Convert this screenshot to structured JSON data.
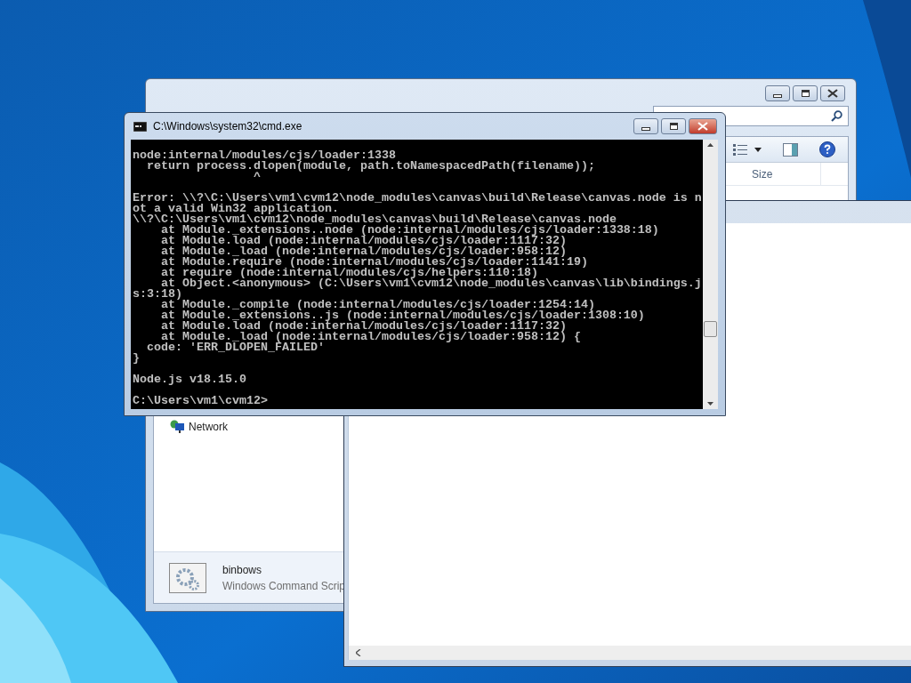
{
  "explorer": {
    "columns": [
      "Size"
    ],
    "nav_items": [
      "Network"
    ],
    "details": {
      "name": "binbows",
      "type": "Windows Command Scrip"
    }
  },
  "cmd": {
    "title": "C:\\Windows\\system32\\cmd.exe",
    "output": "\nnode:internal/modules/cjs/loader:1338\n  return process.dlopen(module, path.toNamespacedPath(filename));\n                 ^\n\nError: \\\\?\\C:\\Users\\vm1\\cvm12\\node_modules\\canvas\\build\\Release\\canvas.node is n\not a valid Win32 application.\n\\\\?\\C:\\Users\\vm1\\cvm12\\node_modules\\canvas\\build\\Release\\canvas.node\n    at Module._extensions..node (node:internal/modules/cjs/loader:1338:18)\n    at Module.load (node:internal/modules/cjs/loader:1117:32)\n    at Module._load (node:internal/modules/cjs/loader:958:12)\n    at Module.require (node:internal/modules/cjs/loader:1141:19)\n    at require (node:internal/modules/cjs/helpers:110:18)\n    at Object.<anonymous> (C:\\Users\\vm1\\cvm12\\node_modules\\canvas\\lib\\bindings.j\ns:3:18)\n    at Module._compile (node:internal/modules/cjs/loader:1254:14)\n    at Module._extensions..js (node:internal/modules/cjs/loader:1308:10)\n    at Module.load (node:internal/modules/cjs/loader:1117:32)\n    at Module._load (node:internal/modules/cjs/loader:958:12) {\n  code: 'ERR_DLOPEN_FAILED'\n}\n\nNode.js v18.15.0\n\nC:\\Users\\vm1\\cvm12>"
  }
}
